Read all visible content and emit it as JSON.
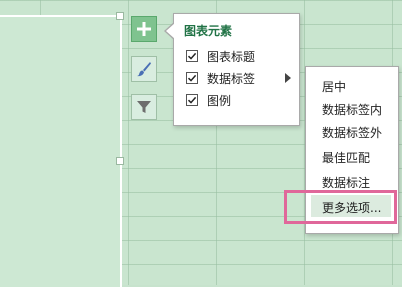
{
  "chart_elements_panel": {
    "title": "图表元素",
    "items": [
      {
        "label": "图表标题",
        "checked": true
      },
      {
        "label": "数据标签",
        "checked": true
      },
      {
        "label": "图例",
        "checked": true
      }
    ]
  },
  "data_label_submenu": {
    "items": [
      "居中",
      "数据标签内",
      "数据标签外",
      "最佳匹配",
      "数据标注",
      "更多选项..."
    ],
    "highlighted_item": "更多选项..."
  },
  "side_buttons": {
    "icons": [
      "plus-icon",
      "brush-icon",
      "filter-icon"
    ],
    "active": "plus-icon"
  },
  "colors": {
    "accent": "#217346",
    "highlight_frame": "#e0679a",
    "sheet_background": "#c9e5cf",
    "active_button": "#7fc38f"
  }
}
